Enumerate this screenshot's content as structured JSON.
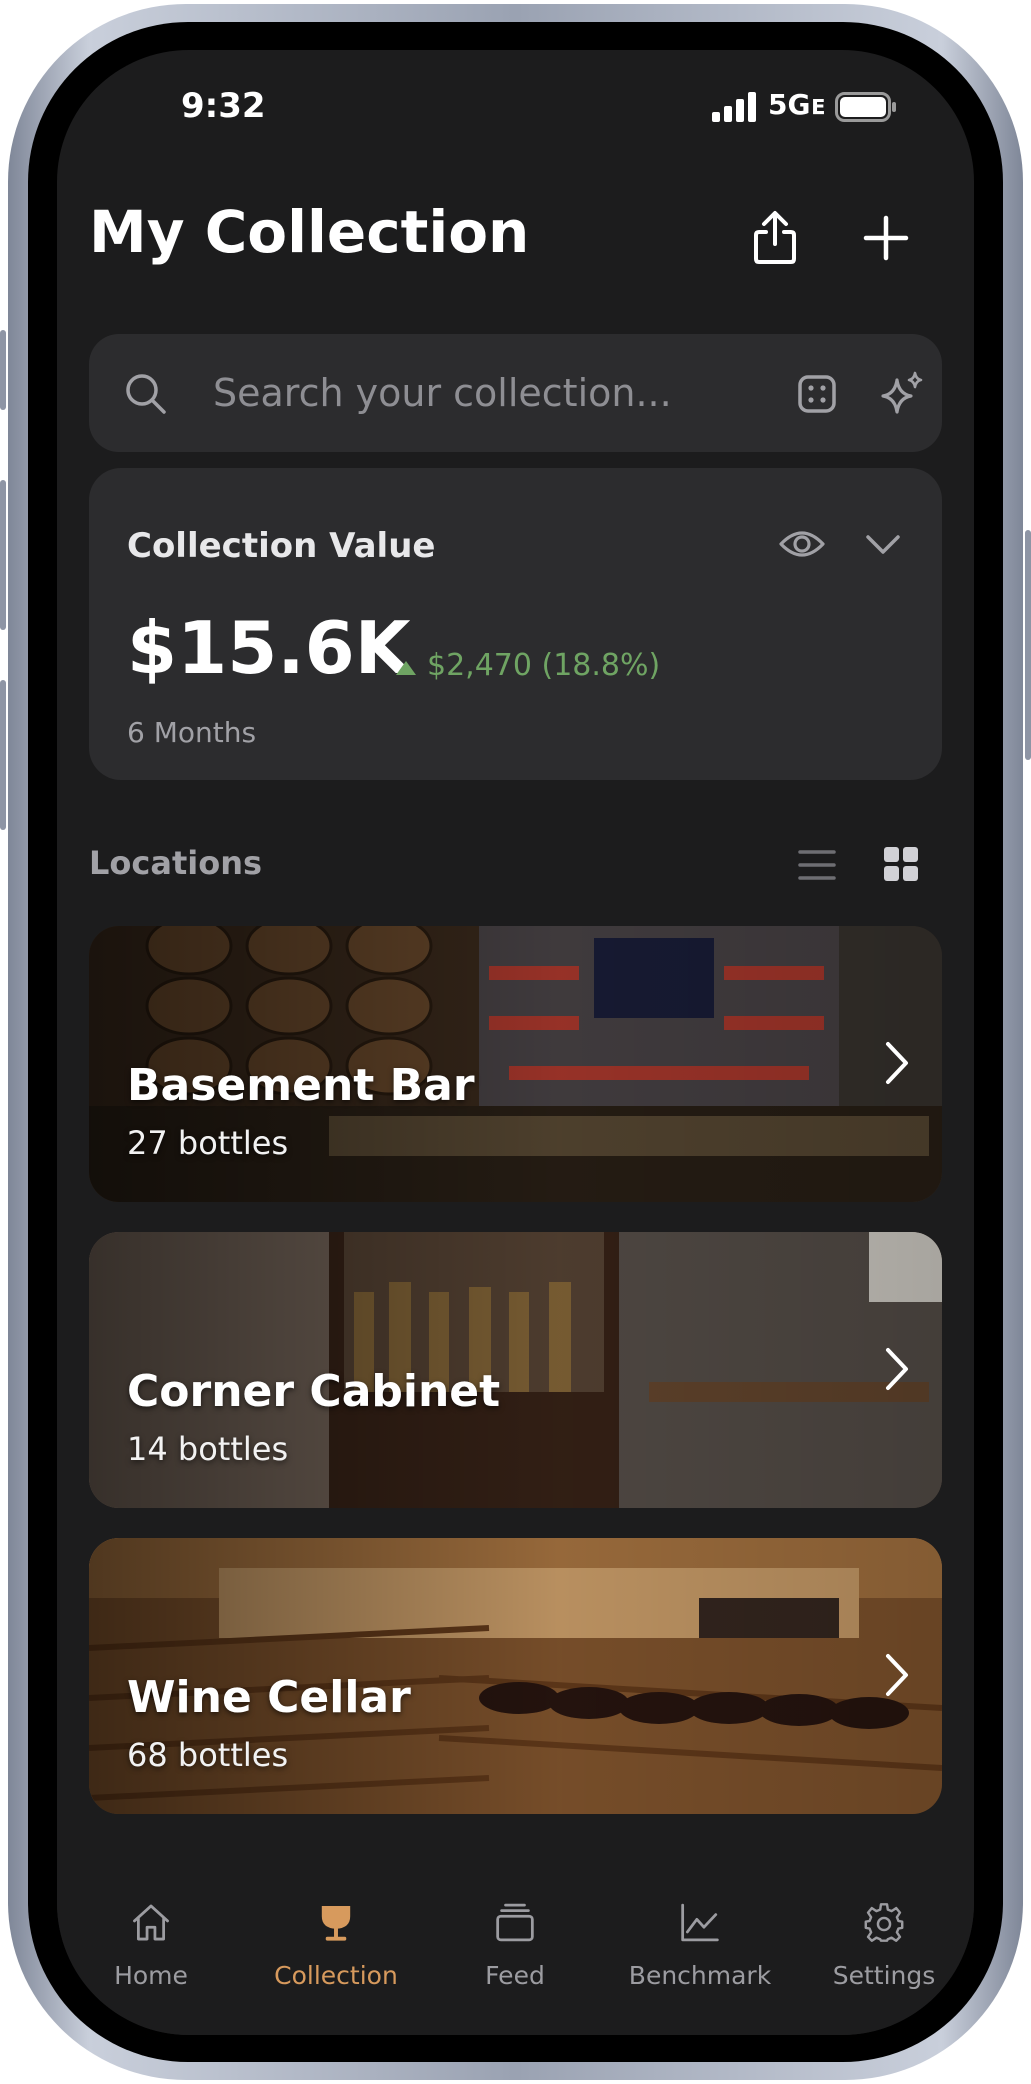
{
  "status_bar": {
    "time": "9:32",
    "network": "5Gᴇ"
  },
  "header": {
    "title": "My Collection",
    "share_icon": "share-icon",
    "add_icon": "plus-icon"
  },
  "search": {
    "placeholder": "Search your collection..."
  },
  "collection_value": {
    "title": "Collection Value",
    "amount": "$15.6K",
    "change": "$2,470 (18.8%)",
    "change_color": "#6fa463",
    "period": "6 Months"
  },
  "locations": {
    "title": "Locations",
    "items": [
      {
        "name": "Basement Bar",
        "count": "27 bottles"
      },
      {
        "name": "Corner Cabinet",
        "count": "14 bottles"
      },
      {
        "name": "Wine Cellar",
        "count": "68 bottles"
      }
    ]
  },
  "tabbar": {
    "accent": "#d79a5d",
    "items": [
      {
        "label": "Home",
        "icon": "home-icon"
      },
      {
        "label": "Collection",
        "icon": "glass-icon",
        "active": true
      },
      {
        "label": "Feed",
        "icon": "stack-icon"
      },
      {
        "label": "Benchmark",
        "icon": "chart-icon"
      },
      {
        "label": "Settings",
        "icon": "gear-icon"
      }
    ]
  }
}
